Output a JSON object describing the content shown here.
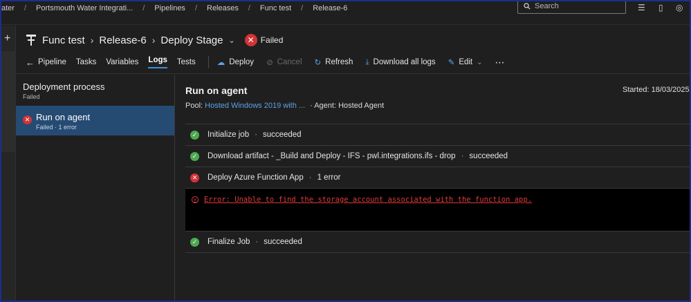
{
  "breadcrumbs": [
    "ater",
    "Portsmouth Water Integrati...",
    "Pipelines",
    "Releases",
    "Func test",
    "Release-6"
  ],
  "search": {
    "placeholder": "Search"
  },
  "title": {
    "pipeline": "Func test",
    "release": "Release-6",
    "stage": "Deploy Stage",
    "status": "Failed"
  },
  "toolbar": {
    "tabs": [
      "Pipeline",
      "Tasks",
      "Variables",
      "Logs",
      "Tests"
    ],
    "active_tab": "Logs",
    "actions": {
      "deploy": "Deploy",
      "cancel": "Cancel",
      "refresh": "Refresh",
      "download": "Download all logs",
      "edit": "Edit"
    }
  },
  "sidebar": {
    "process_title": "Deployment process",
    "process_status": "Failed",
    "stage_name": "Run on agent",
    "stage_status": "Failed · 1 error"
  },
  "main": {
    "title": "Run on agent",
    "started": "Started: 18/03/2025,",
    "pool_label": "Pool:",
    "pool_value": "Hosted Windows 2019 with ...",
    "agent": "· Agent: Hosted Agent",
    "jobs": [
      {
        "name": "Initialize job",
        "status": "succeeded"
      },
      {
        "name": "Download artifact - _Build and Deploy - IFS - pwl.integrations.ifs - drop",
        "status": "succeeded"
      },
      {
        "name": "Deploy Azure Function App",
        "status": "1 error"
      },
      {
        "name": "Finalize Job",
        "status": "succeeded"
      }
    ],
    "error_message": "Error: Unable to find the storage account associated with the function app."
  },
  "colors": {
    "failed": "#d13438",
    "succeeded": "#4fa84f",
    "link": "#5ba3e6",
    "selected": "#264b73"
  }
}
